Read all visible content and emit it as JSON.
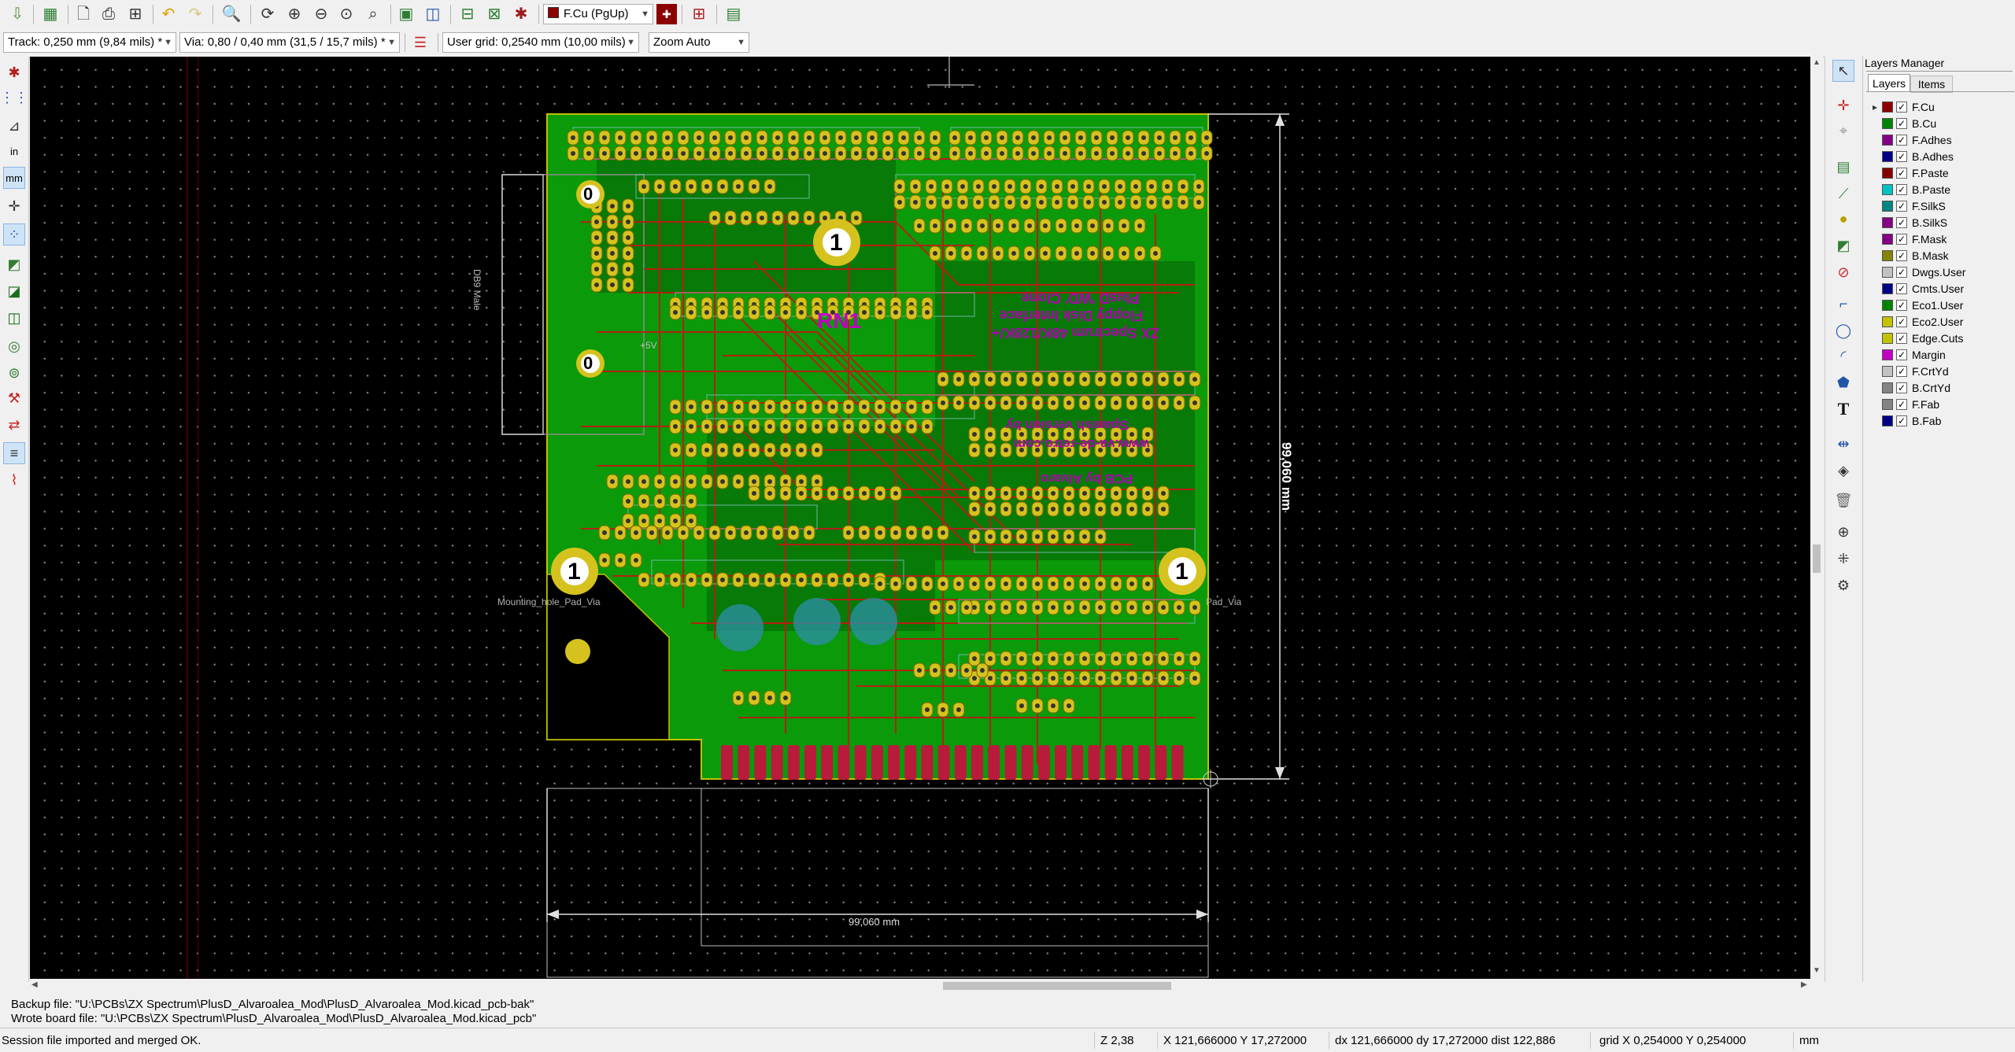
{
  "toolbar": {
    "layer_select": "F.Cu (PgUp)",
    "track_select": "Track: 0,250 mm (9,84 mils) *",
    "via_select": "Via: 0,80 / 0,40 mm (31,5 / 15,7 mils) *",
    "grid_select": "User grid: 0,2540 mm (10,00 mils)",
    "zoom_select": "Zoom Auto"
  },
  "left_toolbar": {
    "units_in": "in",
    "units_mm": "mm"
  },
  "board": {
    "connector_label": "DB9 Male",
    "silk_text_1": "+5V",
    "silk_text_2": "ZX Spectrum 48K/128K/+",
    "silk_text_3": "Floppy Disk Interface",
    "silk_text_4": "PlusD 'WD' Clone",
    "silk_text_5": "Spanish version by",
    "silk_text_6": "www.va-de-retro.com",
    "silk_text_7": "PCB by Alvaro",
    "mounting_left": "Mounting_hole_Pad_Via",
    "mounting_right": "Pad_Via",
    "dim_vertical": "99,060 mm",
    "dim_horizontal": "99,060 mm",
    "mark_zero": "0",
    "mark_one": "1",
    "ref_rn": "RN1"
  },
  "layers_manager": {
    "title": "Layers Manager",
    "tabs": [
      "Layers",
      "Items"
    ],
    "layers": [
      {
        "name": "F.Cu",
        "color": "#8c0000"
      },
      {
        "name": "B.Cu",
        "color": "#008400"
      },
      {
        "name": "F.Adhes",
        "color": "#840084"
      },
      {
        "name": "B.Adhes",
        "color": "#000084"
      },
      {
        "name": "F.Paste",
        "color": "#840000"
      },
      {
        "name": "B.Paste",
        "color": "#00c2c2"
      },
      {
        "name": "F.SilkS",
        "color": "#008484"
      },
      {
        "name": "B.SilkS",
        "color": "#840084"
      },
      {
        "name": "F.Mask",
        "color": "#840084"
      },
      {
        "name": "B.Mask",
        "color": "#848400"
      },
      {
        "name": "Dwgs.User",
        "color": "#c2c2c2"
      },
      {
        "name": "Cmts.User",
        "color": "#000084"
      },
      {
        "name": "Eco1.User",
        "color": "#008400"
      },
      {
        "name": "Eco2.User",
        "color": "#c2c200"
      },
      {
        "name": "Edge.Cuts",
        "color": "#c2c200"
      },
      {
        "name": "Margin",
        "color": "#c200c2"
      },
      {
        "name": "F.CrtYd",
        "color": "#c2c2c2"
      },
      {
        "name": "B.CrtYd",
        "color": "#848484"
      },
      {
        "name": "F.Fab",
        "color": "#848484"
      },
      {
        "name": "B.Fab",
        "color": "#000084"
      }
    ]
  },
  "messages": {
    "line1": "Backup file: \"U:\\PCBs\\ZX Spectrum\\PlusD_Alvaroalea_Mod\\PlusD_Alvaroalea_Mod.kicad_pcb-bak\"",
    "line2": "Wrote board file: \"U:\\PCBs\\ZX Spectrum\\PlusD_Alvaroalea_Mod\\PlusD_Alvaroalea_Mod.kicad_pcb\""
  },
  "status": {
    "message": "Session file imported and merged OK.",
    "zoom": "Z 2,38",
    "xy": "X 121,666000  Y 17,272000",
    "dxy": "dx 121,666000  dy 17,272000  dist 122,886",
    "grid": "grid X 0,254000  Y 0,254000",
    "units": "mm"
  }
}
